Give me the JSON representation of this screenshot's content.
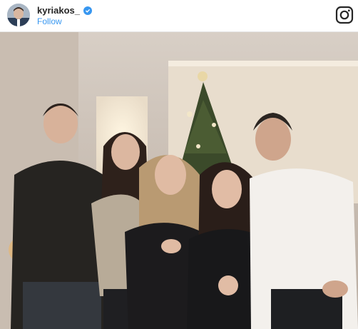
{
  "post": {
    "username": "kyriakos_",
    "follow_label": "Follow",
    "photo_alt": "",
    "colors": {
      "link": "#3897f0",
      "text": "#262626",
      "verified": "#3897f0"
    },
    "icons": [
      "verified-badge-icon",
      "instagram-logo-icon"
    ]
  }
}
